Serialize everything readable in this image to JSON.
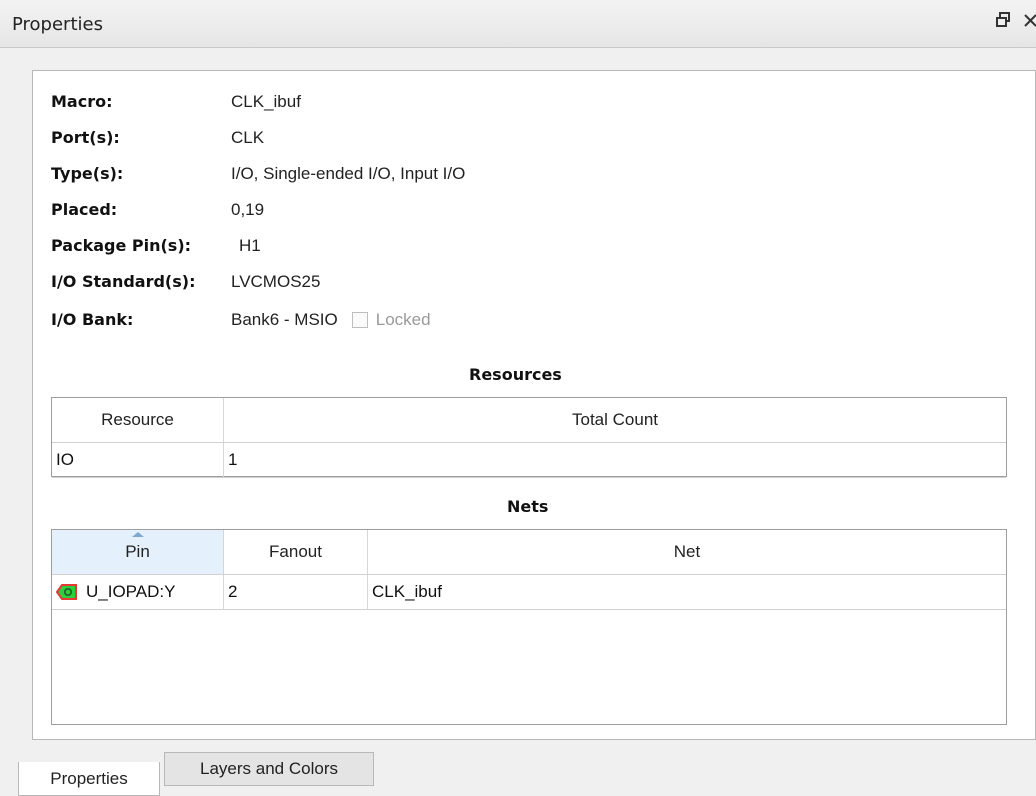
{
  "panel": {
    "title": "Properties",
    "restore_icon": "restore-window-icon",
    "close_icon": "close-icon"
  },
  "properties": {
    "macro_label": "Macro:",
    "macro_value": "CLK_ibuf",
    "ports_label": "Port(s):",
    "ports_value": "CLK",
    "types_label": "Type(s):",
    "types_value": "I/O, Single-ended I/O, Input I/O",
    "placed_label": "Placed:",
    "placed_value": "0,19",
    "package_pins_label": "Package Pin(s):",
    "package_pins_value": "H1",
    "io_standard_label": "I/O Standard(s):",
    "io_standard_value": "LVCMOS25",
    "io_bank_label": "I/O Bank:",
    "io_bank_value": "Bank6 - MSIO",
    "locked_label": "Locked",
    "locked_checked": false
  },
  "resources": {
    "heading": "Resources",
    "columns": [
      "Resource",
      "Total Count"
    ],
    "rows": [
      {
        "resource": "IO",
        "total_count": "1"
      }
    ]
  },
  "nets": {
    "heading": "Nets",
    "columns": [
      "Pin",
      "Fanout",
      "Net"
    ],
    "sorted_column": "Pin",
    "rows": [
      {
        "pin": "U_IOPAD:Y",
        "pin_icon": "output-pin-icon",
        "fanout": "2",
        "net": "CLK_ibuf"
      }
    ]
  },
  "tabs": [
    {
      "label": "Properties",
      "active": true
    },
    {
      "label": "Layers and Colors",
      "active": false
    }
  ],
  "colors": {
    "pin_icon_fill": "#2ecc40",
    "pin_icon_border": "#e53935",
    "sorted_header": "#e4f0fb"
  }
}
